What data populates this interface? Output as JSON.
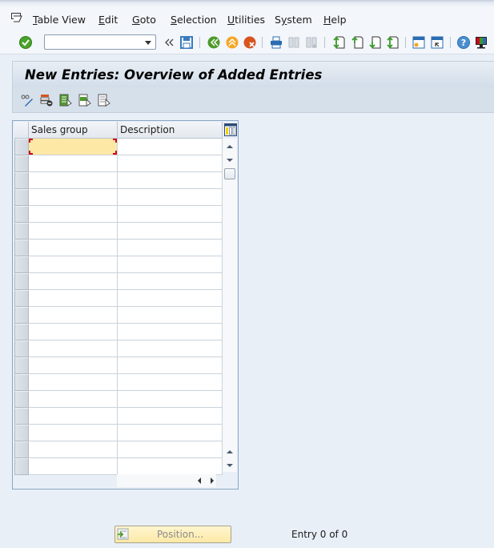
{
  "menubar": {
    "items": [
      {
        "label": "Table View",
        "mnemonic": "T"
      },
      {
        "label": "Edit",
        "mnemonic": "E"
      },
      {
        "label": "Goto",
        "mnemonic": "G"
      },
      {
        "label": "Selection",
        "mnemonic": "S"
      },
      {
        "label": "Utilities",
        "mnemonic": "U"
      },
      {
        "label": "System",
        "mnemonic": "y"
      },
      {
        "label": "Help",
        "mnemonic": "H"
      }
    ]
  },
  "toolbar": {
    "command_field_value": "",
    "icons": [
      "enter-icon",
      "command-field",
      "expand-icon",
      "save-icon",
      "back-icon",
      "exit-icon",
      "cancel-icon",
      "print-icon",
      "find-icon",
      "find-next-icon",
      "first-page-icon",
      "previous-page-icon",
      "next-page-icon",
      "last-page-icon",
      "create-session-icon",
      "shortcut-icon",
      "help-icon",
      "customize-layout-icon"
    ]
  },
  "title": "New Entries: Overview of Added Entries",
  "app_toolbar": {
    "icons": [
      "display-change-icon",
      "delete-icon",
      "select-all-icon",
      "select-block-icon",
      "deselect-all-icon"
    ]
  },
  "table": {
    "columns": [
      "Sales group",
      "Description"
    ],
    "row_count": 20,
    "rows": []
  },
  "footer": {
    "position_button": "Position...",
    "entry_status": "Entry 0 of 0"
  },
  "colors": {
    "background": "#e9eff7",
    "focus_cell": "#fde9a5",
    "focus_corner": "#d0021b"
  }
}
